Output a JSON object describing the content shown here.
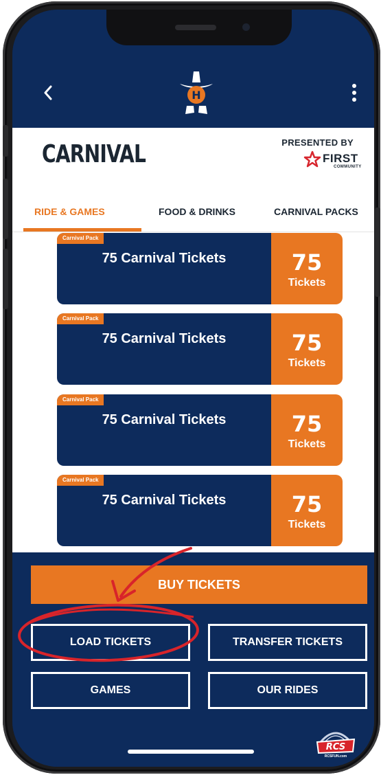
{
  "header": {
    "back_icon": "chevron-left-icon",
    "logo_icon": "cowboy-hat-boots-logo",
    "menu_icon": "more-vertical-icon"
  },
  "title": "CARNIVAL",
  "sponsor": {
    "label": "PRESENTED BY",
    "name": "FIRST",
    "subname": "COMMUNITY",
    "icon": "star-icon",
    "color": "#d7262e"
  },
  "tabs": [
    {
      "label": "RIDE & GAMES",
      "active": true
    },
    {
      "label": "FOOD & DRINKS",
      "active": false
    },
    {
      "label": "CARNIVAL PACKS",
      "active": false
    }
  ],
  "cards": [
    {
      "badge": "Carnival Pack",
      "title": "75 Carnival Tickets",
      "qty": "75",
      "unit": "Tickets"
    },
    {
      "badge": "Carnival Pack",
      "title": "75 Carnival Tickets",
      "qty": "75",
      "unit": "Tickets"
    },
    {
      "badge": "Carnival Pack",
      "title": "75 Carnival Tickets",
      "qty": "75",
      "unit": "Tickets"
    },
    {
      "badge": "Carnival Pack",
      "title": "75 Carnival Tickets",
      "qty": "75",
      "unit": "Tickets"
    }
  ],
  "actions": {
    "buy": "BUY TICKETS",
    "load": "LOAD TICKETS",
    "transfer": "TRANSFER TICKETS",
    "games": "GAMES",
    "rides": "OUR RIDES"
  },
  "footer": {
    "brand_icon": "rcs-logo",
    "brand_text": "RCS",
    "brand_url": "RCSFUN.com"
  },
  "colors": {
    "navy": "#0d2b5c",
    "orange": "#e87722",
    "annotation_red": "#d8242a"
  }
}
